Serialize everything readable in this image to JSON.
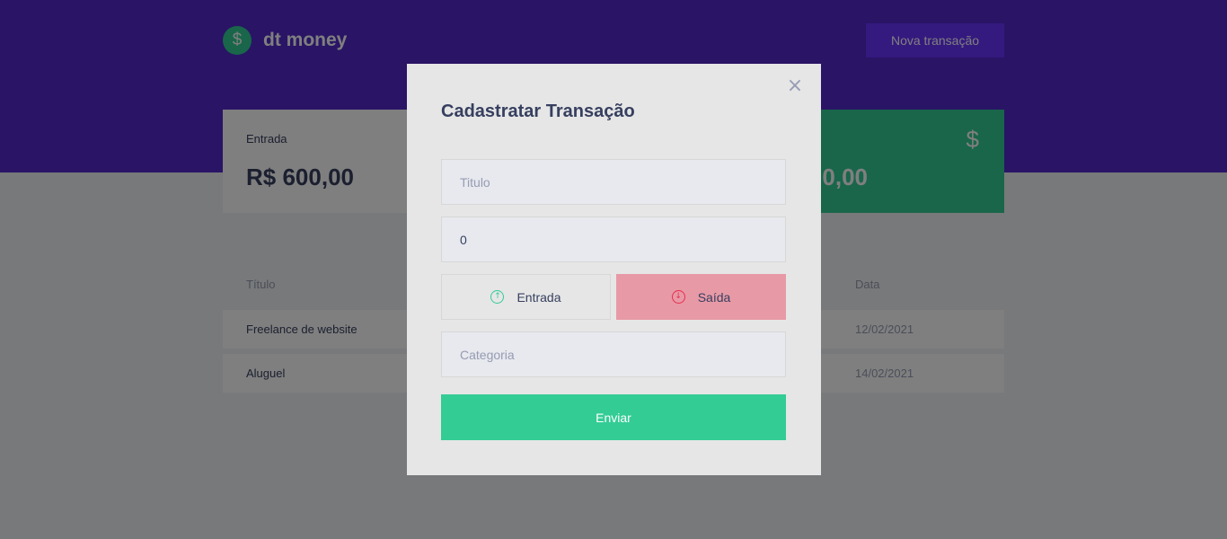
{
  "header": {
    "brand": "dt money",
    "new_transaction_label": "Nova transação"
  },
  "summary": {
    "income": {
      "label": "Entrada",
      "amount": "R$ 600,00"
    },
    "total": {
      "amount_visible": "0,00"
    }
  },
  "table": {
    "headers": [
      "Título",
      "Data"
    ],
    "rows": [
      {
        "title": "Freelance de website",
        "date": "12/02/2021"
      },
      {
        "title": "Aluguel",
        "date": "14/02/2021"
      }
    ]
  },
  "modal": {
    "title": "Cadastratar Transação",
    "title_placeholder": "Titulo",
    "amount_value": "0",
    "income_label": "Entrada",
    "outcome_label": "Saída",
    "category_placeholder": "Categoria",
    "submit_label": "Enviar"
  },
  "colors": {
    "header_bg": "#5429cc",
    "accent_green": "#33cc95",
    "accent_red": "#e52e4d",
    "button_purple": "#6933ff"
  },
  "icons": {
    "logo": "dollar-circle-icon",
    "total": "dollar-icon",
    "close": "close-icon",
    "income": "arrow-up-circle-icon",
    "outcome": "arrow-down-circle-icon"
  }
}
